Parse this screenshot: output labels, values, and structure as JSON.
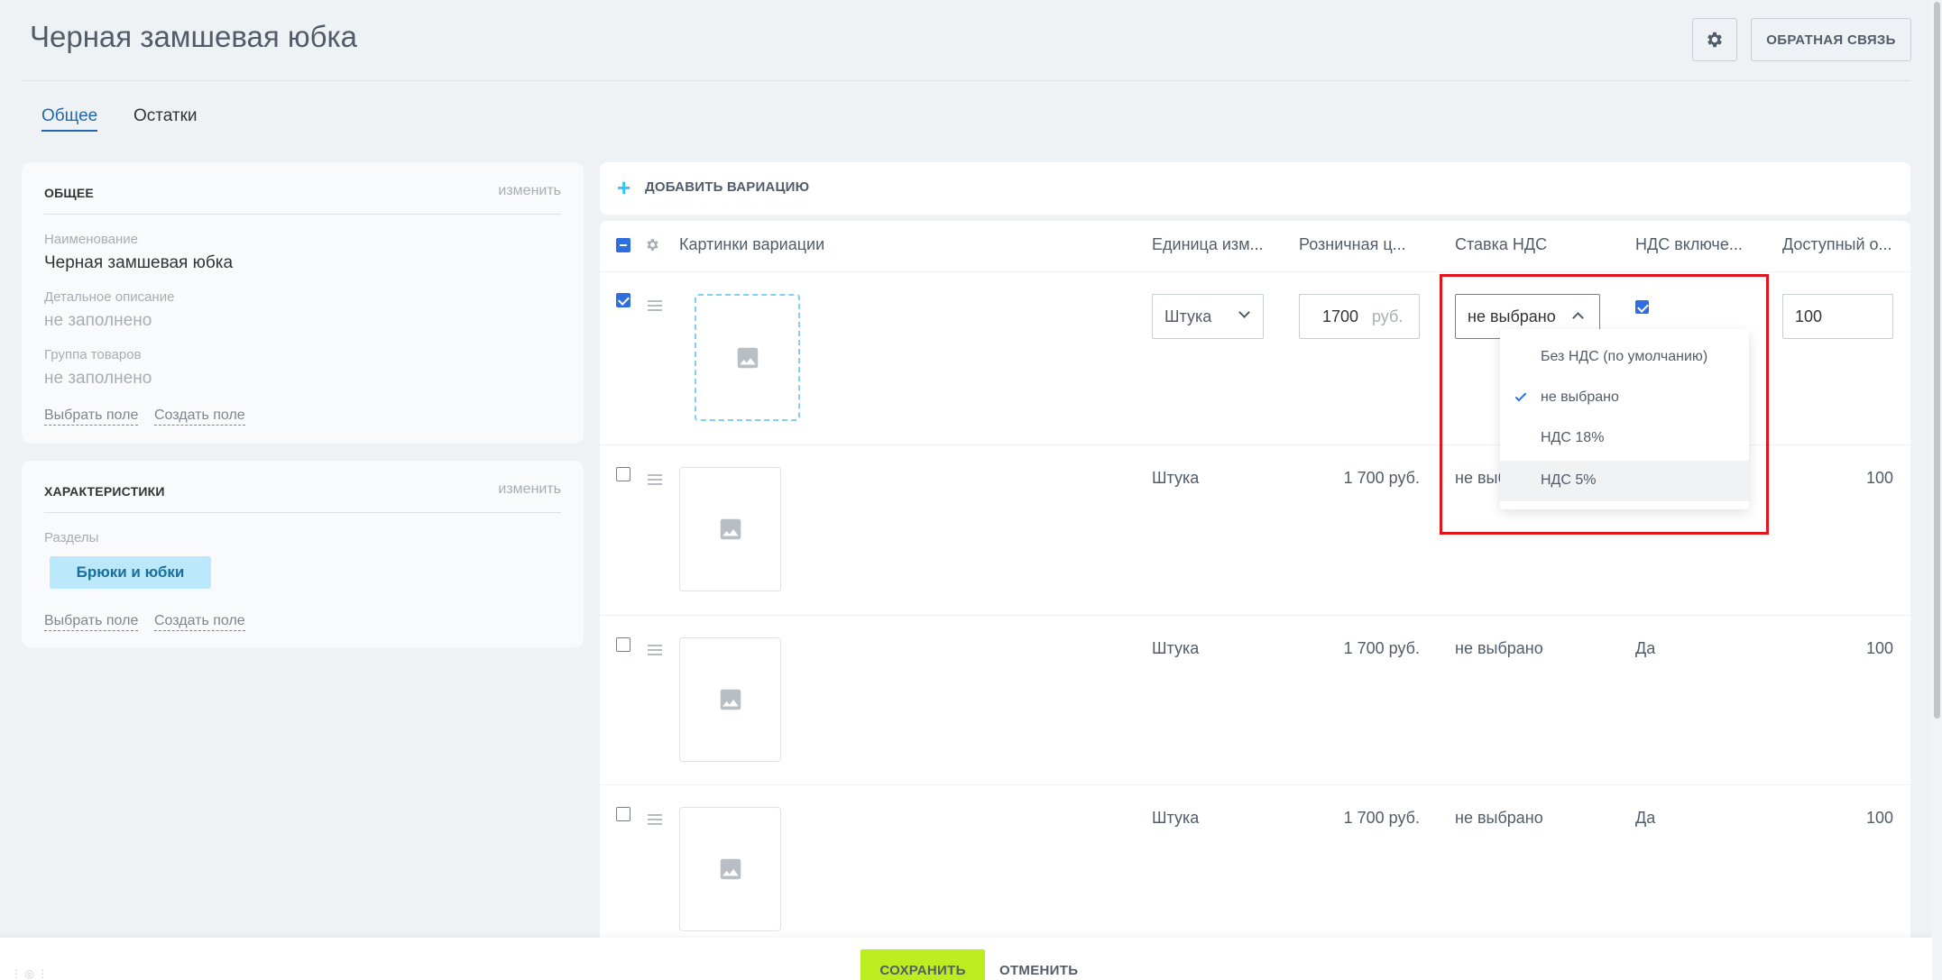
{
  "header": {
    "title": "Черная замшевая юбка",
    "feedback_label": "ОБРАТНАЯ СВЯЗЬ"
  },
  "tabs": [
    {
      "label": "Общее",
      "active": true
    },
    {
      "label": "Остатки",
      "active": false
    }
  ],
  "general_card": {
    "heading": "ОБЩЕЕ",
    "edit_label": "изменить",
    "name_label": "Наименование",
    "name_value": "Черная замшевая юбка",
    "description_label": "Детальное описание",
    "description_value": "не заполнено",
    "group_label": "Группа товаров",
    "group_value": "не заполнено",
    "choose_field": "Выбрать поле",
    "create_field": "Создать поле"
  },
  "props_card": {
    "heading": "ХАРАКТЕРИСТИКИ",
    "edit_label": "изменить",
    "sections_label": "Разделы",
    "section_tag": "Брюки и юбки",
    "choose_field": "Выбрать поле",
    "create_field": "Создать поле"
  },
  "variations": {
    "add_label": "ДОБАВИТЬ ВАРИАЦИЮ",
    "columns": {
      "images": "Картинки вариации",
      "unit": "Единица изм...",
      "price": "Розничная ц...",
      "vat_rate": "Ставка НДС",
      "vat_included": "НДС включе...",
      "available": "Доступный о..."
    },
    "edit_row": {
      "checked": true,
      "unit": "Штука",
      "price": "1700",
      "currency": "руб.",
      "vat_rate": "не выбрано",
      "vat_included": true,
      "available": "100"
    },
    "rows": [
      {
        "unit": "Штука",
        "price": "1 700 руб.",
        "vat_rate": "не выб",
        "vat_included": "",
        "available": "100"
      },
      {
        "unit": "Штука",
        "price": "1 700 руб.",
        "vat_rate": "не выбрано",
        "vat_included": "Да",
        "available": "100"
      },
      {
        "unit": "Штука",
        "price": "1 700 руб.",
        "vat_rate": "не выбрано",
        "vat_included": "Да",
        "available": "100"
      }
    ]
  },
  "vat_dropdown": {
    "options": [
      {
        "label": "Без НДС (по умолчанию)",
        "selected": false
      },
      {
        "label": "не выбрано",
        "selected": true
      },
      {
        "label": "НДС 18%",
        "selected": false
      },
      {
        "label": "НДС 5%",
        "selected": false,
        "hovered": true
      }
    ]
  },
  "footer": {
    "save_label": "СОХРАНИТЬ",
    "cancel_label": "ОТМЕНИТЬ"
  },
  "colors": {
    "accent_blue": "#2067b0",
    "checkbox_blue": "#2f6ee0",
    "save_green": "#bbed21",
    "highlight_red": "#e4141b",
    "tag_bg": "#bce8fb"
  }
}
